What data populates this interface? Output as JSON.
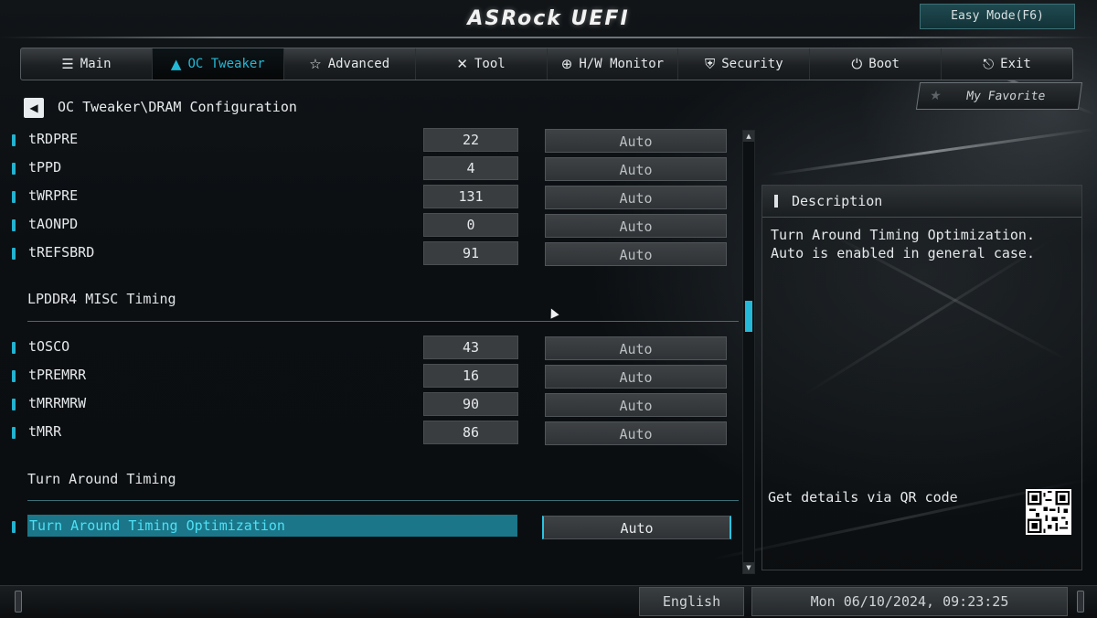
{
  "header": {
    "logo": "ASRock UEFI",
    "easy_mode": "Easy Mode(F6)"
  },
  "tabs": [
    {
      "label": "Main",
      "icon": "list-icon",
      "glyph": "☰",
      "active": false
    },
    {
      "label": "OC Tweaker",
      "icon": "rocket-icon",
      "glyph": "🚀",
      "active": true
    },
    {
      "label": "Advanced",
      "icon": "star-wrench-icon",
      "glyph": "☆",
      "active": false
    },
    {
      "label": "Tool",
      "icon": "tools-icon",
      "glyph": "✕",
      "active": false
    },
    {
      "label": "H/W Monitor",
      "icon": "crosshair-icon",
      "glyph": "⊕",
      "active": false
    },
    {
      "label": "Security",
      "icon": "shield-icon",
      "glyph": "⛨",
      "active": false
    },
    {
      "label": "Boot",
      "icon": "power-icon",
      "glyph": "⏻",
      "active": false
    },
    {
      "label": "Exit",
      "icon": "exit-door-icon",
      "glyph": "⎋",
      "active": false
    }
  ],
  "favorite": {
    "label": "My Favorite"
  },
  "breadcrumb": "OC Tweaker\\DRAM Configuration",
  "settings_top": [
    {
      "name": "tRDPRE",
      "value": "22",
      "option": "Auto"
    },
    {
      "name": "tPPD",
      "value": "4",
      "option": "Auto"
    },
    {
      "name": "tWRPRE",
      "value": "131",
      "option": "Auto"
    },
    {
      "name": "tAONPD",
      "value": "0",
      "option": "Auto"
    },
    {
      "name": "tREFSBRD",
      "value": "91",
      "option": "Auto"
    }
  ],
  "section_misc": "LPDDR4 MISC Timing",
  "settings_misc": [
    {
      "name": "tOSCO",
      "value": "43",
      "option": "Auto"
    },
    {
      "name": "tPREMRR",
      "value": "16",
      "option": "Auto"
    },
    {
      "name": "tMRRMRW",
      "value": "90",
      "option": "Auto"
    },
    {
      "name": "tMRR",
      "value": "86",
      "option": "Auto"
    }
  ],
  "section_turn": "Turn Around Timing",
  "selected_setting": {
    "name": "Turn Around Timing Optimization",
    "option": "Auto"
  },
  "description": {
    "title": "Description",
    "text": "Turn Around Timing Optimization.\nAuto is enabled in general case.",
    "qr_label": "Get details via QR code"
  },
  "footer": {
    "language": "English",
    "datetime": "Mon 06/10/2024, 09:23:25"
  },
  "colors": {
    "accent": "#23b9d6",
    "highlight_row": "#1a7688",
    "panel": "#3a3d40"
  }
}
